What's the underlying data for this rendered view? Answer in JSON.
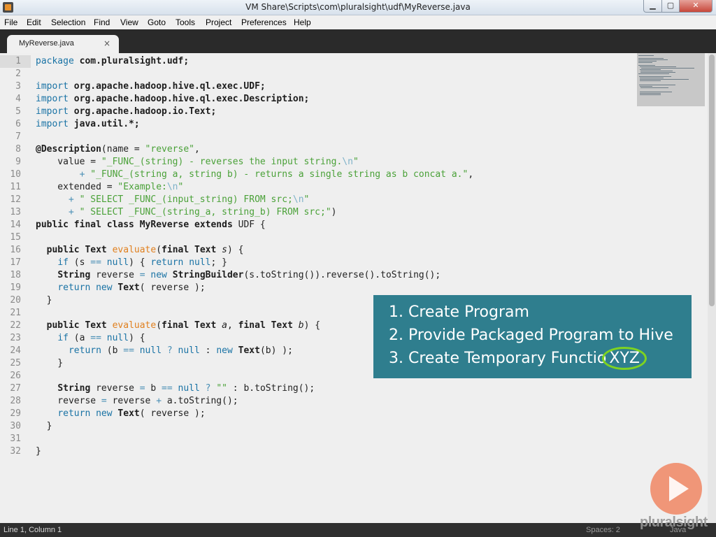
{
  "window": {
    "title": "VM Share\\Scripts\\com\\pluralsight\\udf\\MyReverse.java",
    "minimize_glyph": "▁",
    "maximize_glyph": "▢",
    "close_glyph": "✕"
  },
  "menu": [
    "File",
    "Edit",
    "Selection",
    "Find",
    "View",
    "Goto",
    "Tools",
    "Project",
    "Preferences",
    "Help"
  ],
  "tab": {
    "label": "MyReverse.java",
    "close_glyph": "×"
  },
  "code_lines": [
    "1",
    "2",
    "3",
    "4",
    "5",
    "6",
    "7",
    "8",
    "9",
    "10",
    "11",
    "12",
    "13",
    "14",
    "15",
    "16",
    "17",
    "18",
    "19",
    "20",
    "21",
    "22",
    "23",
    "24",
    "25",
    "26",
    "27",
    "28",
    "29",
    "30",
    "31",
    "32"
  ],
  "code": {
    "l1": {
      "kw": "package",
      "rest": " com.pluralsight.udf;"
    },
    "l3": {
      "kw": "import",
      "rest": " org.apache.hadoop.hive.ql.exec.UDF;"
    },
    "l4": {
      "kw": "import",
      "rest": " org.apache.hadoop.hive.ql.exec.Description;"
    },
    "l5": {
      "kw": "import",
      "rest": " org.apache.hadoop.io.Text;"
    },
    "l6": {
      "kw": "import",
      "rest": " java.util.*;"
    },
    "l8": {
      "anno": "@Description",
      "a": "(name = ",
      "s": "\"reverse\"",
      "b": ","
    },
    "l9": {
      "a": "    value = ",
      "s1": "\"_FUNC_(string) - reverses the input string.",
      "esc": "\\n",
      "s2": "\""
    },
    "l10": {
      "a": "        ",
      "op": "+",
      "s": " \"_FUNC_(string a, string b) - returns a single string as b concat a.\"",
      "b": ","
    },
    "l11": {
      "a": "    extended = ",
      "s1": "\"Example:",
      "esc": "\\n",
      "s2": "\""
    },
    "l12": {
      "a": "      ",
      "op": "+",
      "s1": " \" SELECT _FUNC_(input_string) FROM src;",
      "esc": "\\n",
      "s2": "\""
    },
    "l13": {
      "a": "      ",
      "op": "+",
      "s": " \" SELECT _FUNC_(string_a, string_b) FROM src;\"",
      "b": ")"
    },
    "l14": {
      "k1": "public final class",
      "a": " ",
      "cls": "MyReverse",
      "b": " ",
      "k2": "extends",
      "c": " UDF {"
    },
    "l16": {
      "a": "  ",
      "k1": "public",
      "b": " ",
      "t": "Text",
      "c": " ",
      "fn": "evaluate",
      "d": "(",
      "k2": "final",
      "e": " ",
      "t2": "Text",
      "f": " ",
      "p": "s",
      "g": ") {"
    },
    "l17": {
      "a": "    ",
      "k1": "if",
      "b": " (s ",
      "op": "==",
      "c": " ",
      "n": "null",
      "d": ") { ",
      "k2": "return",
      "e": " ",
      "n2": "null",
      "f": "; }"
    },
    "l18": {
      "a": "    ",
      "t": "String",
      "b": " reverse ",
      "op": "=",
      "c": " ",
      "k": "new",
      "d": " ",
      "t2": "StringBuilder",
      "e": "(s.toString()).reverse().toString();"
    },
    "l19": {
      "a": "    ",
      "k1": "return",
      "b": " ",
      "k2": "new",
      "c": " ",
      "t": "Text",
      "d": "( reverse );"
    },
    "l20": {
      "a": "  }"
    },
    "l22": {
      "a": "  ",
      "k1": "public",
      "b": " ",
      "t": "Text",
      "c": " ",
      "fn": "evaluate",
      "d": "(",
      "k2": "final",
      "e": " ",
      "t2": "Text",
      "f": " ",
      "p": "a",
      "g": ", ",
      "k3": "final",
      "h": " ",
      "t3": "Text",
      "i": " ",
      "p2": "b",
      "j": ") {"
    },
    "l23": {
      "a": "    ",
      "k1": "if",
      "b": " (a ",
      "op": "==",
      "c": " ",
      "n": "null",
      "d": ") {"
    },
    "l24": {
      "a": "      ",
      "k1": "return",
      "b": " (b ",
      "op": "==",
      "c": " ",
      "n": "null",
      "d": " ",
      "op2": "?",
      "e": " ",
      "n2": "null",
      "f": " : ",
      "k2": "new",
      "g": " ",
      "t": "Text",
      "h": "(b) );"
    },
    "l25": {
      "a": "    }"
    },
    "l27": {
      "a": "    ",
      "t": "String",
      "b": " reverse ",
      "op": "=",
      "c": " b ",
      "op2": "==",
      "d": " ",
      "n": "null",
      "e": " ",
      "op3": "?",
      "f": " ",
      "s": "\"\"",
      "g": " : b.toString();"
    },
    "l28": {
      "a": "    reverse ",
      "op": "=",
      "b": " reverse ",
      "op2": "+",
      "c": " a.toString();"
    },
    "l29": {
      "a": "    ",
      "k1": "return",
      "b": " ",
      "k2": "new",
      "c": " ",
      "t": "Text",
      "d": "( reverse );"
    },
    "l30": {
      "a": "  }"
    },
    "l32": {
      "a": "}"
    }
  },
  "overlay": {
    "item1": "1. Create Program",
    "item2": "2. Provide Packaged Program to Hive",
    "item3_prefix": "3. Create Temporary Functio",
    "item3_highlight": "XYZ"
  },
  "status": {
    "position": "Line 1, Column 1",
    "spaces": "Spaces: 2",
    "language": "Java"
  },
  "watermark": {
    "brand": "pluralsight"
  }
}
